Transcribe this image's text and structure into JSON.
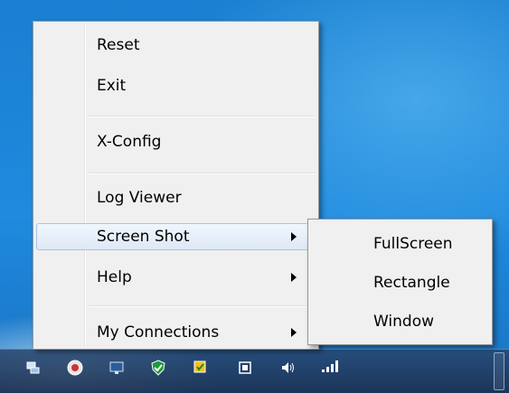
{
  "context_menu": {
    "items": [
      {
        "label": "Reset"
      },
      {
        "label": "Exit"
      },
      {
        "label": "X-Config"
      },
      {
        "label": "Log Viewer"
      },
      {
        "label": "Screen Shot"
      },
      {
        "label": "Help"
      },
      {
        "label": "My Connections"
      }
    ]
  },
  "submenu_screen_shot": {
    "items": [
      {
        "label": "FullScreen"
      },
      {
        "label": "Rectangle"
      },
      {
        "label": "Window"
      }
    ]
  },
  "tray": {
    "icons": [
      "network-icon",
      "antivirus-icon",
      "monitor-icon",
      "shield-check-icon",
      "action-center-icon",
      "display-icon",
      "volume-icon",
      "signal-strength-icon"
    ]
  },
  "colors": {
    "menu_bg": "#f0f0f0",
    "highlight_border": "#a9c3e3",
    "desktop_blue": "#1f86d6"
  }
}
